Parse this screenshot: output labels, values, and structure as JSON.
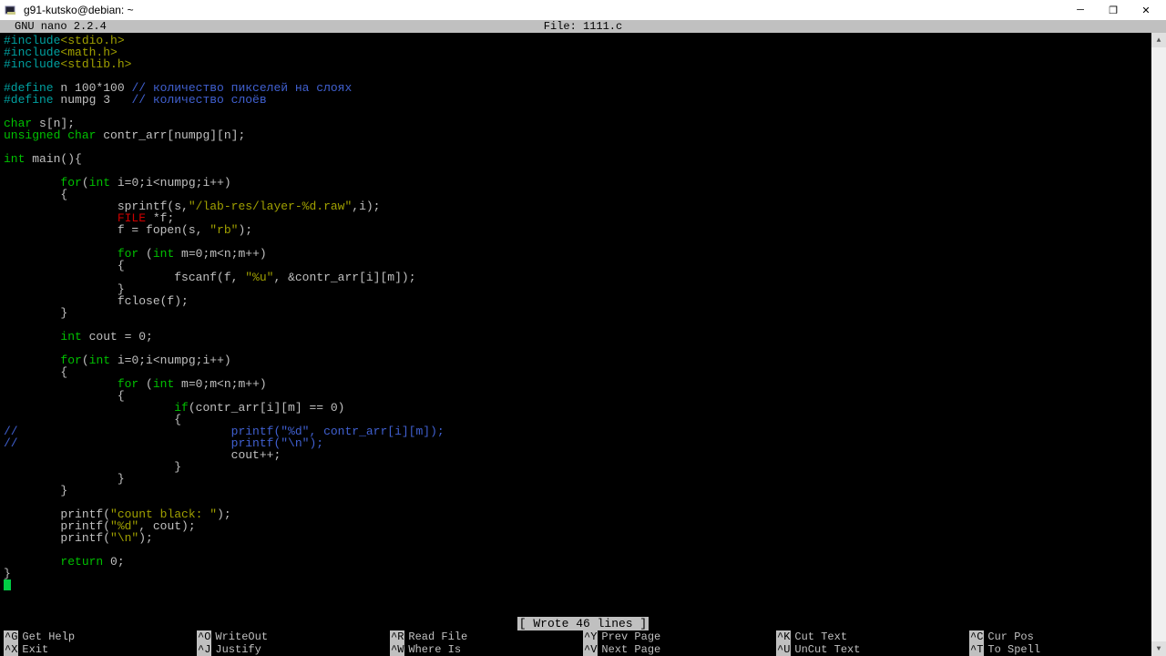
{
  "window": {
    "title": "g91-kutsko@debian: ~"
  },
  "nano": {
    "app": "GNU nano 2.2.4",
    "file_label": "File: 1111.c",
    "status": "[ Wrote 46 lines ]"
  },
  "code": {
    "l01a": "#include",
    "l01b": "<stdio.h>",
    "l02a": "#include",
    "l02b": "<math.h>",
    "l03a": "#include",
    "l03b": "<stdlib.h>",
    "l05a": "#define",
    "l05b": " n 100*100 ",
    "l05c": "// количество пикселей на слоях",
    "l06a": "#define",
    "l06b": " numpg 3   ",
    "l06c": "// количество слоёв",
    "l08a": "char",
    "l08b": " s[n];",
    "l09a": "unsigned char",
    "l09b": " contr_arr[numpg][n];",
    "l11a": "int",
    "l11b": " main(){",
    "l13a": "        ",
    "l13b": "for",
    "l13c": "(",
    "l13d": "int",
    "l13e": " i=0;i<numpg;i++)",
    "l14": "        {",
    "l15a": "                sprintf(s,",
    "l15b": "\"/lab-res/layer-%d.raw\"",
    "l15c": ",i);",
    "l16a": "                ",
    "l16b": "FILE",
    "l16c": " *f;",
    "l17a": "                f = fopen(s, ",
    "l17b": "\"rb\"",
    "l17c": ");",
    "l19a": "                ",
    "l19b": "for",
    "l19c": " (",
    "l19d": "int",
    "l19e": " m=0;m<n;m++)",
    "l20": "                {",
    "l21a": "                        fscanf(f, ",
    "l21b": "\"%u\"",
    "l21c": ", &contr_arr[i][m]);",
    "l22": "                }",
    "l23": "                fclose(f);",
    "l24": "        }",
    "l26a": "        ",
    "l26b": "int",
    "l26c": " cout = 0;",
    "l28a": "        ",
    "l28b": "for",
    "l28c": "(",
    "l28d": "int",
    "l28e": " i=0;i<numpg;i++)",
    "l29": "        {",
    "l30a": "                ",
    "l30b": "for",
    "l30c": " (",
    "l30d": "int",
    "l30e": " m=0;m<n;m++)",
    "l31": "                {",
    "l32a": "                        ",
    "l32b": "if",
    "l32c": "(contr_arr[i][m] == 0)",
    "l33": "                        {",
    "l34a": "//",
    "l34b": "                              printf(\"%d\", contr_arr[i][m]);",
    "l35a": "//",
    "l35b": "                              printf(\"\\n\");",
    "l36": "                                cout++;",
    "l37": "                        }",
    "l38": "                }",
    "l39": "        }",
    "l41a": "        printf(",
    "l41b": "\"count black: \"",
    "l41c": ");",
    "l42a": "        printf(",
    "l42b": "\"%d\"",
    "l42c": ", cout);",
    "l43a": "        printf(",
    "l43b": "\"\\n\"",
    "l43c": ");",
    "l45a": "        ",
    "l45b": "return",
    "l45c": " 0;",
    "l46": "}"
  },
  "shortcuts": [
    {
      "key": "^G",
      "label": "Get Help"
    },
    {
      "key": "^O",
      "label": "WriteOut"
    },
    {
      "key": "^R",
      "label": "Read File"
    },
    {
      "key": "^Y",
      "label": "Prev Page"
    },
    {
      "key": "^K",
      "label": "Cut Text"
    },
    {
      "key": "^C",
      "label": "Cur Pos"
    },
    {
      "key": "^X",
      "label": "Exit"
    },
    {
      "key": "^J",
      "label": "Justify"
    },
    {
      "key": "^W",
      "label": "Where Is"
    },
    {
      "key": "^V",
      "label": "Next Page"
    },
    {
      "key": "^U",
      "label": "UnCut Text"
    },
    {
      "key": "^T",
      "label": "To Spell"
    }
  ]
}
